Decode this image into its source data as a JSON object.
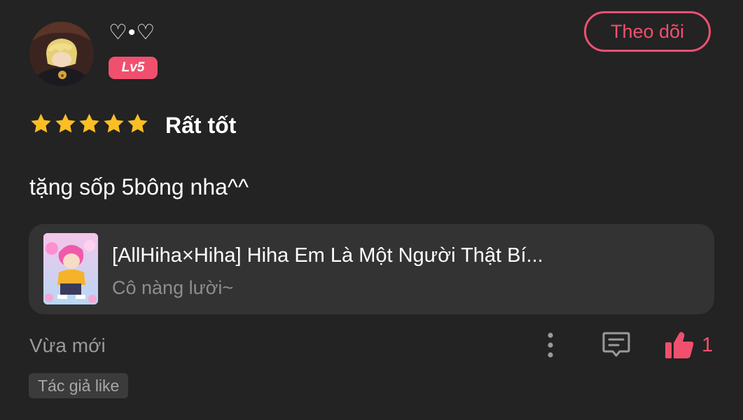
{
  "user": {
    "name": "♡•♡",
    "level": "Lv5",
    "avatar_icon": "anime-avatar"
  },
  "follow_button": {
    "label": "Theo dõi"
  },
  "review": {
    "stars": 5,
    "rating_label": "Rất tốt",
    "comment": "tặng sốp 5bông nha^^"
  },
  "book": {
    "title": "[AllHiha×Hiha] Hiha Em Là Một Người Thật Bí...",
    "author": "Cô nàng lười~",
    "cover_icon": "book-cover-image"
  },
  "footer": {
    "time": "Vừa mới",
    "like_count": "1",
    "author_like_tag": "Tác giả like"
  },
  "colors": {
    "background": "#232323",
    "accent": "#f0506e",
    "star": "#fbbf24",
    "card": "#333333",
    "muted_text": "#9a9a9a"
  }
}
